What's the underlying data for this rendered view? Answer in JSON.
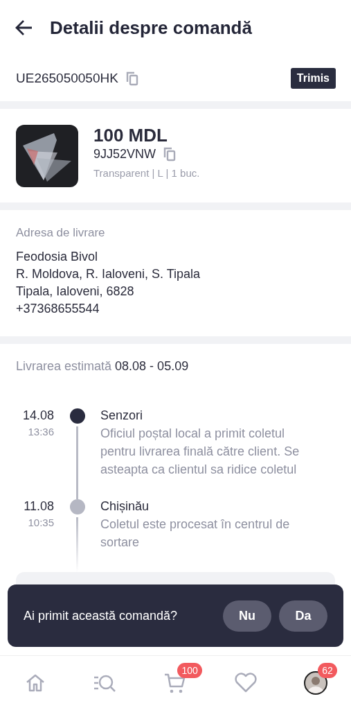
{
  "header": {
    "title": "Detalii despre comandă"
  },
  "tracking": {
    "number": "UE265050050HK",
    "status": "Trimis"
  },
  "product": {
    "price": "100 MDL",
    "code": "9JJ52VNW",
    "variant": "Transparent | L | 1 buc."
  },
  "address": {
    "label": "Adresa de livrare",
    "lines": [
      "Feodosia Bivol",
      "R. Moldova, R. Ialoveni, S. Tipala",
      "Tipala, Ialoveni, 6828",
      "+37368655544"
    ]
  },
  "estimate": {
    "label": "Livrarea estimată",
    "value": "08.08 - 05.09"
  },
  "events": [
    {
      "date": "14.08",
      "time": "13:36",
      "place": "Senzori",
      "text": "Oficiul poștal local a primit coletul pentru livrarea finală către client. Se asteapta ca clientul sa ridice coletul",
      "active": true
    },
    {
      "date": "11.08",
      "time": "10:35",
      "place": "Chișinău",
      "text": "Coletul este procesat în centrul de sortare",
      "active": false
    }
  ],
  "prompt": {
    "question": "Ai primit această comandă?",
    "buttons": [
      "Nu",
      "Da"
    ]
  },
  "nav": [
    {
      "kind": "home",
      "selected": false
    },
    {
      "kind": "search",
      "selected": false
    },
    {
      "kind": "cart",
      "badge": "100",
      "selected": false
    },
    {
      "kind": "heart",
      "selected": false
    },
    {
      "kind": "avatar",
      "badge": "62",
      "selected": false
    }
  ]
}
